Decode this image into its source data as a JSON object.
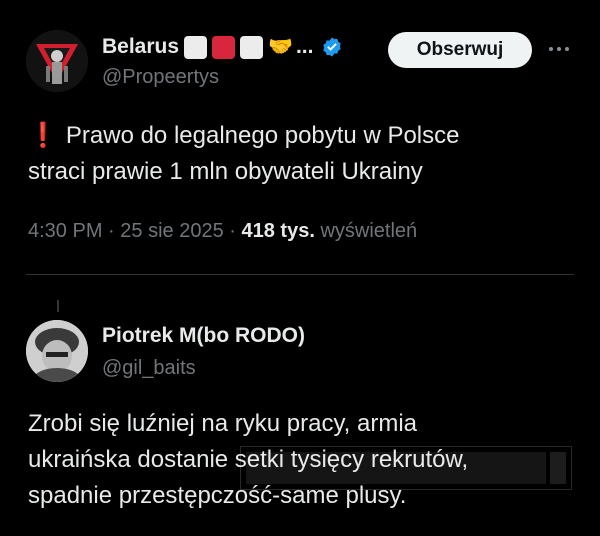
{
  "main_tweet": {
    "display_name": "Belarus",
    "name_suffix": "...",
    "flag_icons": [
      "white-square",
      "red-square",
      "white-square"
    ],
    "emoji_icon": "handshake",
    "handle": "@Propeertys",
    "follow_label": "Obserwuj",
    "text_exclamation": "❗",
    "text_line1": "Prawo do legalnego pobytu w Polsce",
    "text_line2": "straci prawie 1 mln obywateli Ukrainy",
    "time": "4:30 PM",
    "separator": "·",
    "date": "25 sie 2025",
    "views_count": "418 tys.",
    "views_label": "wyświetleń"
  },
  "reply": {
    "display_name": "Piotrek M(bo RODO)",
    "handle": "@gil_baits",
    "text_line1": "Zrobi się luźniej na ryku pracy, armia",
    "text_line2": "ukraińska dostanie setki tysięcy rekrutów,",
    "text_line3": "spadnie przestępczość-same plusy."
  },
  "colors": {
    "background": "#000000",
    "text": "#e7e9ea",
    "secondary": "#71767b",
    "verified": "#1d9bf0",
    "exclamation": "#e0202d",
    "follow_bg": "#eff3f4"
  }
}
